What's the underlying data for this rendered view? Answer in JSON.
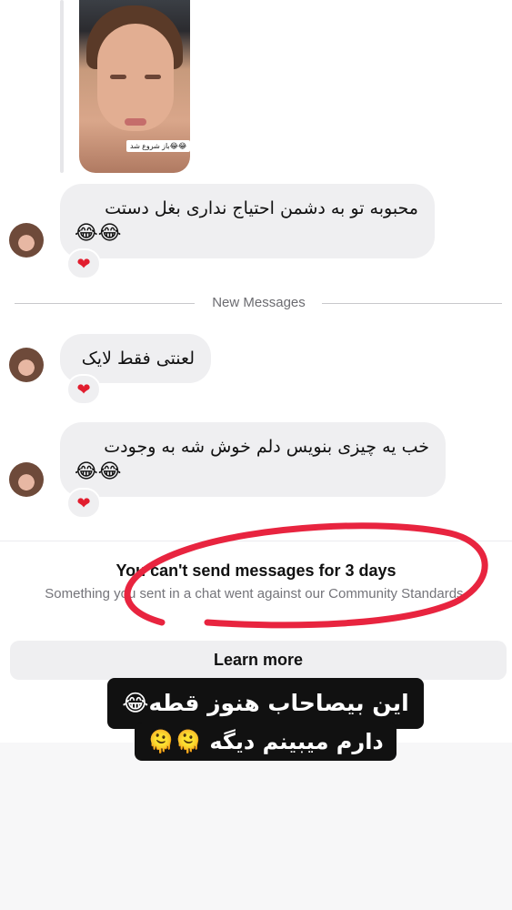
{
  "video_message": {
    "caption": "باز شروع شد😂😂"
  },
  "messages": [
    {
      "text": "محبوبه تو به دشمن احتیاج نداری بغل دستت",
      "emoji": "😂😂",
      "reaction": "❤"
    },
    {
      "text": "لعنتی فقط لایک",
      "emoji": "",
      "reaction": "❤"
    },
    {
      "text": "خب یه چیزی بنویس دلم خوش شه به وجودت",
      "emoji": "😂😂",
      "reaction": "❤"
    }
  ],
  "divider": {
    "label": "New Messages"
  },
  "restriction": {
    "title": "You can't send messages for 3 days",
    "description": "Something you sent in a chat went against our Community Standards."
  },
  "learn_more": {
    "label": "Learn more"
  },
  "overlay_stickers": {
    "line1": "این بیصاحاب هنوز قطه😂",
    "line2": "دارم میبینم دیگه 🫠🫠"
  },
  "colors": {
    "bubble": "#efeff1",
    "scribble": "#e8243f",
    "heart": "#e11d2e"
  }
}
